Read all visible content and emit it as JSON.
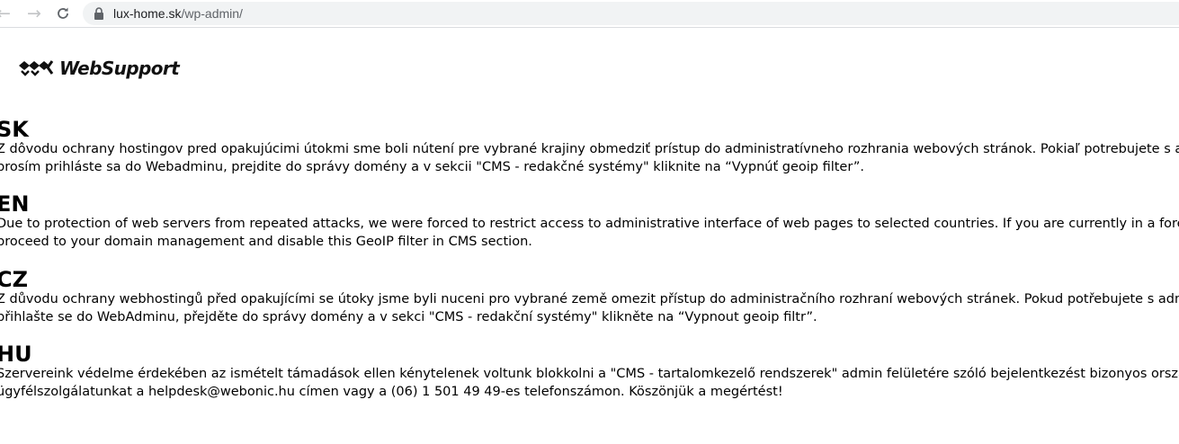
{
  "browser": {
    "url_host": "lux-home.sk",
    "url_path": "/wp-admin/"
  },
  "logo": {
    "text": "WebSupport"
  },
  "sections": [
    {
      "heading": "SK",
      "lines": [
        "Z dôvodu ochrany hostingov pred opakujúcimi útokmi sme boli nútení pre vybrané krajiny obmedziť prístup do administratívneho rozhrania webových stránok. Pokiaľ potrebujete s admini",
        "prosím prihláste sa do Webadminu, prejdite do správy domény a v sekcii \"CMS - redakčné systémy\" kliknite na “Vypnúť geoip filter”."
      ]
    },
    {
      "heading": "EN",
      "lines": [
        "Due to protection of web servers from repeated attacks, we were forced to restrict access to administrative interface of web pages to selected countries. If you are currently in a foreign c",
        "proceed to your domain management and disable this GeoIP filter in CMS section."
      ]
    },
    {
      "heading": "CZ",
      "lines": [
        "Z důvodu ochrany webhostingů před opakujícími se útoky jsme byli nuceni pro vybrané země omezit přístup do administračního rozhraní webových stránek. Pokud potřebujete s administr",
        "přihlašte se do WebAdminu, přejděte do správy domény a v sekci \"CMS - redakční systémy\" klikněte na “Vypnout geoip filtr”."
      ]
    },
    {
      "heading": "HU",
      "lines": [
        "Szervereink védelme érdekében az ismételt támadások ellen kénytelenek voltunk blokkolni a \"CMS - tartalomkezelő rendszerek\" admin felületére szóló bejelentkezést bizonyos országokbó",
        "ügyfélszolgálatunkat a helpdesk@webonic.hu címen vagy a (06) 1 501 49 49-es telefonszámon. Köszönjük a megértést!"
      ]
    }
  ]
}
